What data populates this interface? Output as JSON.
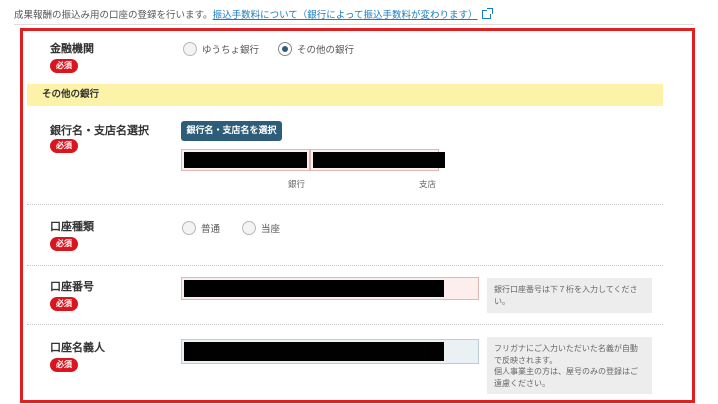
{
  "intro": {
    "text": "成果報酬の振込み用の口座の登録を行います。",
    "link": "振込手数料について（銀行によって振込手数料が変わります）"
  },
  "sections": {
    "institution": {
      "label": "金融機関",
      "required": "必須",
      "options": [
        "ゆうちょ銀行",
        "その他の銀行"
      ],
      "selected": "その他の銀行"
    },
    "other_bank_header": "その他の銀行",
    "bank_branch": {
      "label": "銀行名・支店名選択",
      "required": "必須",
      "button": "銀行名・支店名を選択",
      "bank_caption": "銀行",
      "branch_caption": "支店"
    },
    "account_type": {
      "label": "口座種類",
      "required": "必須",
      "options": [
        "普通",
        "当座"
      ]
    },
    "account_number": {
      "label": "口座番号",
      "required": "必須",
      "help": "銀行口座番号は下７桁を入力してください。"
    },
    "account_holder": {
      "label": "口座名義人",
      "required": "必須",
      "help_lines": [
        "フリガナにご入力いただいた名義が自動で反映されます。",
        "個人事業主の方は、屋号のみの登録はご遠慮ください。"
      ]
    }
  }
}
